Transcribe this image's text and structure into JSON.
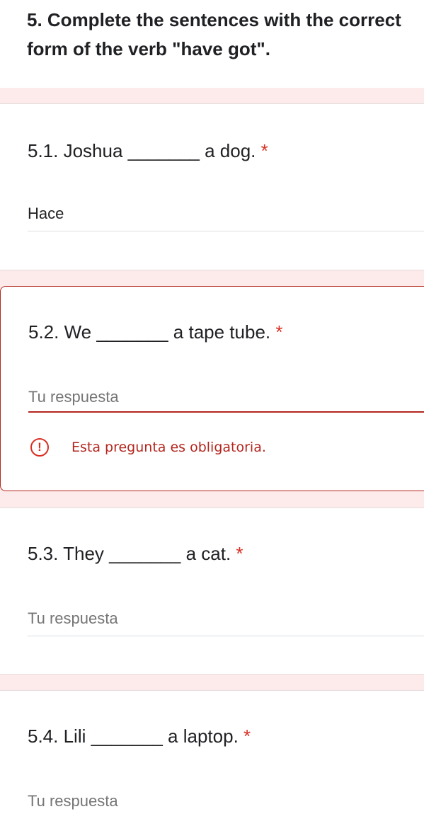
{
  "section": {
    "title": "5. Complete the sentences with the correct form of the verb \"have got\"."
  },
  "questions": [
    {
      "text": "5.1. Joshua _______ a dog.",
      "required_mark": "*",
      "answer_value": "Hace",
      "placeholder": "Tu respuesta"
    },
    {
      "text": "5.2. We _______ a tape tube.",
      "required_mark": "*",
      "answer_value": "",
      "placeholder": "Tu respuesta",
      "error_icon": "!",
      "error": "Esta pregunta es obligatoria."
    },
    {
      "text": "5.3. They _______ a cat.",
      "required_mark": "*",
      "answer_value": "",
      "placeholder": "Tu respuesta"
    },
    {
      "text": "5.4. Lili _______ a laptop.",
      "required_mark": "*",
      "answer_value": "",
      "placeholder": "Tu respuesta"
    }
  ],
  "colors": {
    "page_background": "#fdeaea",
    "required": "#d93025",
    "error": "#b3261e"
  }
}
